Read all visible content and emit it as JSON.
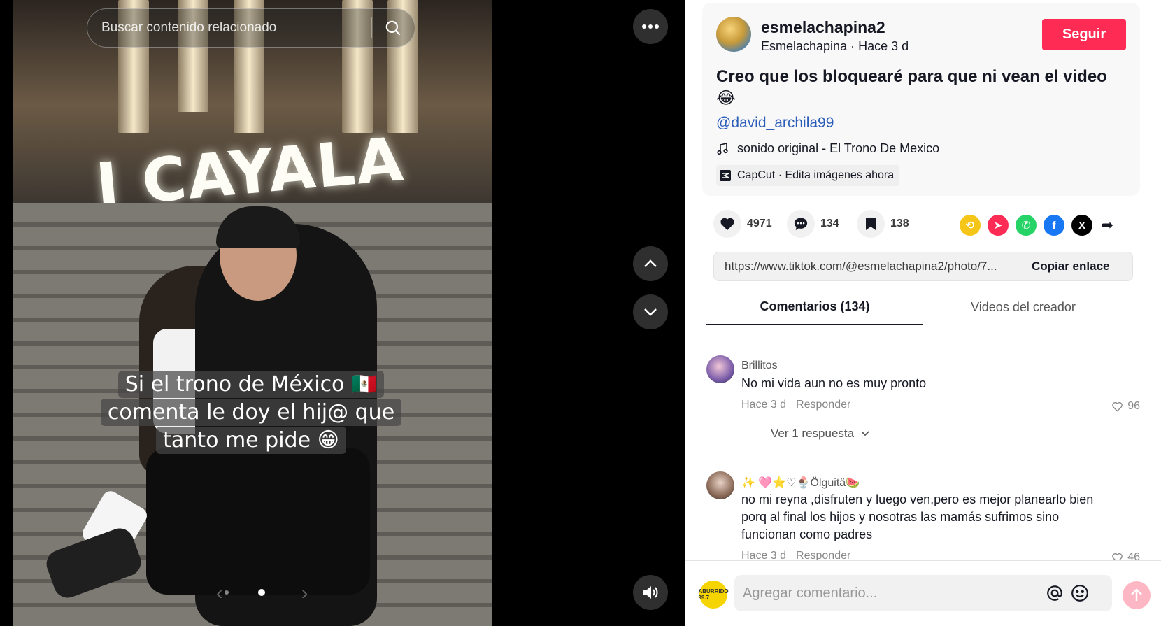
{
  "search": {
    "placeholder": "Buscar contenido relacionado"
  },
  "media": {
    "sign_text": "I CAYALA",
    "caption_lines": [
      "Si el trono de México 🇲🇽",
      "comenta le doy el hij@ que",
      "tanto me pide 😁"
    ]
  },
  "post": {
    "username": "esmelachapina2",
    "display_name": "Esmelachapina",
    "time": "Hace 3 d",
    "subline_sep": " · ",
    "follow_label": "Seguir",
    "description": "Creo que los bloquearé para que ni vean el video 😂",
    "mention": "@david_archila99",
    "sound": "sonido original - El Trono De Mexico",
    "capcut": "CapCut · Edita imágenes ahora"
  },
  "stats": {
    "likes": "4971",
    "comments": "134",
    "saves": "138"
  },
  "share": {
    "link": "https://www.tiktok.com/@esmelachapina2/photo/7...",
    "copy_label": "Copiar enlace"
  },
  "tabs": {
    "comments": "Comentarios (134)",
    "creator_videos": "Videos del creador"
  },
  "comments": [
    {
      "name": "Brillitos",
      "text": "No mi vida aun no es muy pronto",
      "time": "Hace 3 d",
      "reply": "Responder",
      "likes": "96",
      "view_replies": "Ver 1 respuesta"
    },
    {
      "name": "✨ 🩷⭐♡🍨Ölguitä🍉",
      "text": "no mi reyna ,disfruten y luego ven,pero es mejor planearlo bien porq al final los hijos y nosotras las mamás sufrimos sino funcionan como padres",
      "time": "Hace 3 d",
      "reply": "Responder",
      "likes": "46"
    }
  ],
  "composer": {
    "placeholder": "Agregar comentario...",
    "me_avatar_text": "ABURRIDO 99.7"
  },
  "colors": {
    "accent": "#fe2c55",
    "mention": "#2b5db9",
    "repost": "#f5c518",
    "whatsapp": "#25d366",
    "facebook": "#1877f2",
    "x": "#000000"
  }
}
